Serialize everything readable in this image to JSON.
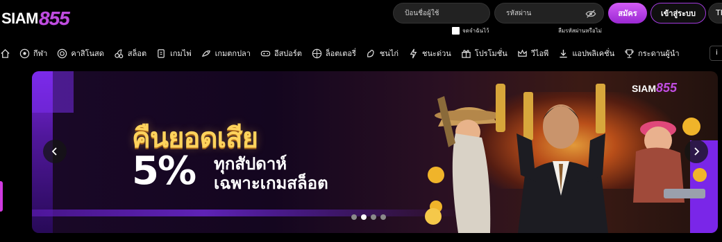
{
  "brand": {
    "logo_word": "SIAM",
    "logo_num": "855"
  },
  "login": {
    "username_placeholder": "ป้อนชื่อผู้ใช้",
    "password_placeholder": "รหัสผ่าน",
    "register_label": "สมัคร",
    "login_label": "เข้าสู่ระบบ",
    "language_label": "TH",
    "remember_label": "จดจำฉันไว้",
    "forgot_label": "ลืมรหัสผ่านหรือไม่"
  },
  "nav": {
    "items": [
      {
        "label": "กีฬา",
        "icon": "soccer-ball-icon"
      },
      {
        "label": "คาสิโนสด",
        "icon": "casino-chip-icon"
      },
      {
        "label": "สล็อต",
        "icon": "slot-cherry-icon"
      },
      {
        "label": "เกมไพ่",
        "icon": "cards-icon"
      },
      {
        "label": "เกมตกปลา",
        "icon": "fish-icon"
      },
      {
        "label": "อีสปอร์ต",
        "icon": "gamepad-icon"
      },
      {
        "label": "ล็อตเตอรี่",
        "icon": "lottery-ball-icon"
      },
      {
        "label": "ชนไก่",
        "icon": "rooster-icon"
      },
      {
        "label": "ชนะด่วน",
        "icon": "lightning-icon"
      },
      {
        "label": "โปรโมชั่น",
        "icon": "gift-icon"
      },
      {
        "label": "วีไอพี",
        "icon": "crown-icon"
      },
      {
        "label": "แอปพลิเคชั่น",
        "icon": "download-icon"
      },
      {
        "label": "กระดานผู้นำ",
        "icon": "trophy-icon"
      }
    ],
    "overflow_label": "i"
  },
  "banner": {
    "line1": "คืนยอดเสีย",
    "percent": "5%",
    "line2": "ทุกสัปดาห์",
    "line3": "เฉพาะเกมสล็อต",
    "brand_word": "SIAM",
    "brand_num": "855",
    "slides": 4,
    "active_slide": 1
  },
  "colors": {
    "accent": "#c04de0",
    "gold": "#ffd35c",
    "background": "#000000"
  }
}
